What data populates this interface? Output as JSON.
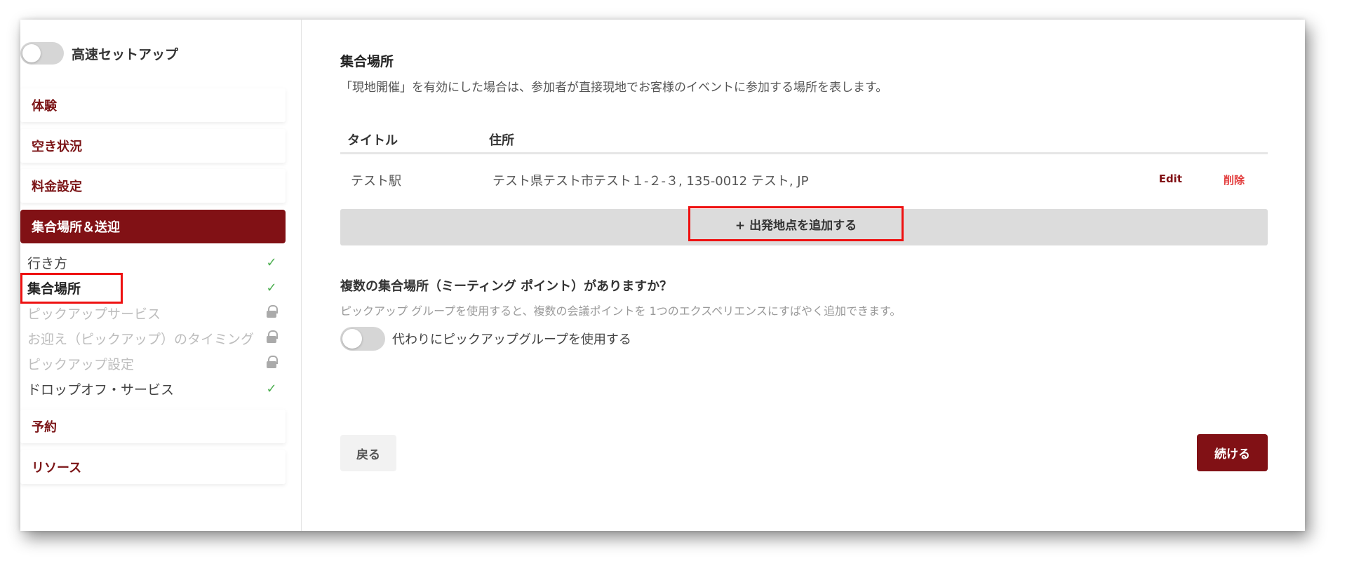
{
  "sidebar": {
    "quick_setup": {
      "label": "高速セットアップ",
      "enabled": false
    },
    "items": [
      {
        "label": "体験"
      },
      {
        "label": "空き状況"
      },
      {
        "label": "料金設定"
      },
      {
        "label": "集合場所＆送迎",
        "active": true
      },
      {
        "label": "予約"
      },
      {
        "label": "リソース"
      }
    ],
    "subitems": [
      {
        "label": "行き方",
        "status": "check"
      },
      {
        "label": "集合場所",
        "status": "check",
        "current": true
      },
      {
        "label": "ピックアップサービス",
        "status": "lock"
      },
      {
        "label": "お迎え（ピックアップ）のタイミング",
        "status": "lock"
      },
      {
        "label": "ピックアップ設定",
        "status": "lock"
      },
      {
        "label": "ドロップオフ・サービス",
        "status": "check"
      }
    ],
    "check_glyph": "✓"
  },
  "main": {
    "title": "集合場所",
    "description": "「現地開催」を有効にした場合は、参加者が直接現地でお客様のイベントに参加する場所を表します。",
    "table": {
      "headers": [
        "タイトル",
        "住所"
      ],
      "rows": [
        {
          "title": "テスト駅",
          "address": "テスト県テスト市テスト１-２-３, 135-0012 テスト, JP",
          "edit": "Edit",
          "delete": "削除"
        }
      ]
    },
    "add_button": "+ 出発地点を追加する",
    "question": {
      "title": "複数の集合場所（ミーティング ポイント）がありますか？",
      "description": "ピックアップ グループを使用すると、複数の会議ポイントを 1つのエクスペリエンスにすばやく追加できます。",
      "toggle_label": "代わりにピックアップグループを使用する",
      "toggle_enabled": false
    },
    "back_button": "戻る",
    "continue_button": "続ける"
  },
  "colors": {
    "brand": "#811115",
    "delete": "#e23b3b",
    "check": "#4caf50",
    "highlight": "#ee1111"
  }
}
